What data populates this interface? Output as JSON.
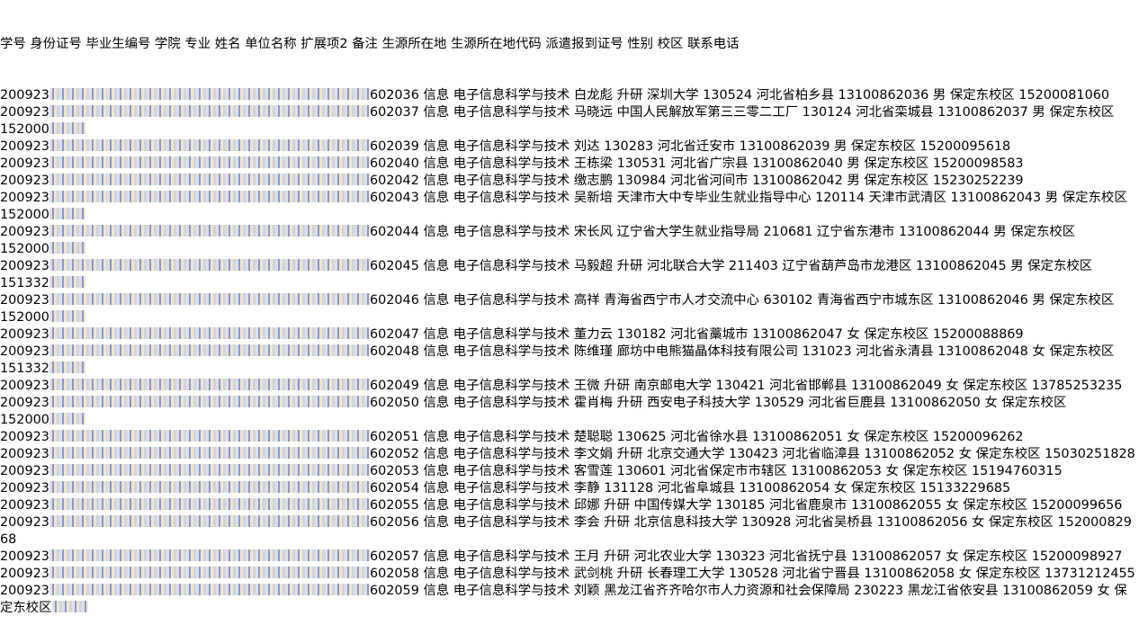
{
  "header": "学号 身份证号 毕业生编号 学院 专业 姓名 单位名称 扩展项2 备注 生源所在地 生源所在地代码 派遣报到证号 性别 校区 联系电话",
  "rows": [
    {
      "prefix": "200923",
      "text": "602036 信息 电子信息科学与技术 白龙彪 升研 深圳大学 130524 河北省柏乡县 13100862036 男 保定东校区 15200081060",
      "wrap": ""
    },
    {
      "prefix": "200923",
      "text": "602037 信息 电子信息科学与技术 马晓远 中国人民解放军第三三零二工厂 130124 河北省栾城县 13100862037 男 保定东校区",
      "wrap": "152000"
    },
    {
      "prefix": "200923",
      "text": "602039 信息 电子信息科学与技术 刘达 130283 河北省迁安市 13100862039 男 保定东校区 15200095618",
      "wrap": ""
    },
    {
      "prefix": "200923",
      "text": "602040 信息 电子信息科学与技术 王栋梁 130531 河北省广宗县 13100862040 男 保定东校区 15200098583",
      "wrap": ""
    },
    {
      "prefix": "200923",
      "text": "602042 信息 电子信息科学与技术 缴志鹏 130984 河北省河间市 13100862042 男 保定东校区 15230252239",
      "wrap": ""
    },
    {
      "prefix": "200923",
      "text": "602043 信息 电子信息科学与技术 吴新培 天津市大中专毕业生就业指导中心 120114 天津市武清区 13100862043 男 保定东校区",
      "wrap": "152000"
    },
    {
      "prefix": "200923",
      "text": "602044 信息 电子信息科学与技术 宋长风 辽宁省大学生就业指导局 210681 辽宁省东港市 13100862044 男 保定东校区",
      "wrap": "152000"
    },
    {
      "prefix": "200923",
      "text": "602045 信息 电子信息科学与技术 马毅超 升研 河北联合大学 211403 辽宁省葫芦岛市龙港区 13100862045 男 保定东校区",
      "wrap": "151332"
    },
    {
      "prefix": "200923",
      "text": "602046 信息 电子信息科学与技术 高祥 青海省西宁市人才交流中心 630102 青海省西宁市城东区 13100862046 男 保定东校区",
      "wrap": "152000"
    },
    {
      "prefix": "200923",
      "text": "602047 信息 电子信息科学与技术 董力云 130182 河北省藁城市 13100862047 女 保定东校区 15200088869",
      "wrap": ""
    },
    {
      "prefix": "200923",
      "text": "602048 信息 电子信息科学与技术 陈维瑾 廊坊中电熊猫晶体科技有限公司 131023 河北省永清县 13100862048 女 保定东校区",
      "wrap": "151332"
    },
    {
      "prefix": "200923",
      "text": "602049 信息 电子信息科学与技术 王微 升研 南京邮电大学 130421 河北省邯郸县 13100862049 女 保定东校区 13785253235",
      "wrap": ""
    },
    {
      "prefix": "200923",
      "text": "602050 信息 电子信息科学与技术 霍肖梅 升研 西安电子科技大学 130529 河北省巨鹿县 13100862050 女 保定东校区",
      "wrap": "152000"
    },
    {
      "prefix": "200923",
      "text": "602051 信息 电子信息科学与技术 楚聪聪 130625 河北省徐水县 13100862051 女 保定东校区 15200096262",
      "wrap": ""
    },
    {
      "prefix": "200923",
      "text": "602052 信息 电子信息科学与技术 李文娟 升研 北京交通大学 130423 河北省临漳县 13100862052 女 保定东校区 15030251828",
      "wrap": ""
    },
    {
      "prefix": "200923",
      "text": "602053 信息 电子信息科学与技术 客雪莲 130601 河北省保定市市辖区 13100862053 女 保定东校区 15194760315",
      "wrap": ""
    },
    {
      "prefix": "200923",
      "text": "602054 信息 电子信息科学与技术 李静 131128 河北省阜城县 13100862054 女 保定东校区 15133229685",
      "wrap": ""
    },
    {
      "prefix": "200923",
      "text": "602055 信息 电子信息科学与技术 邱娜 升研 中国传媒大学 130185 河北省鹿泉市 13100862055 女 保定东校区 15200099656",
      "wrap": ""
    },
    {
      "prefix": "200923",
      "text": "602056 信息 电子信息科学与技术 李会 升研 北京信息科技大学 130928 河北省吴桥县 13100862056 女 保定东校区 15200082968",
      "wrap": ""
    },
    {
      "prefix": "200923",
      "text": "602057 信息 电子信息科学与技术 王月 升研 河北农业大学 130323 河北省抚宁县 13100862057 女 保定东校区 15200098927",
      "wrap": ""
    },
    {
      "prefix": "200923",
      "text": "602058 信息 电子信息科学与技术 武剑桃 升研 长春理工大学 130528 河北省宁晋县 13100862058 女 保定东校区 13731212455",
      "wrap": ""
    },
    {
      "prefix": "200923",
      "text": "602059 信息 电子信息科学与技术 刘颖 黑龙江省齐齐哈尔市人力资源和社会保障局 230223 黑龙江省依安县 13100862059 女 保",
      "wrap": "定东校区"
    }
  ]
}
